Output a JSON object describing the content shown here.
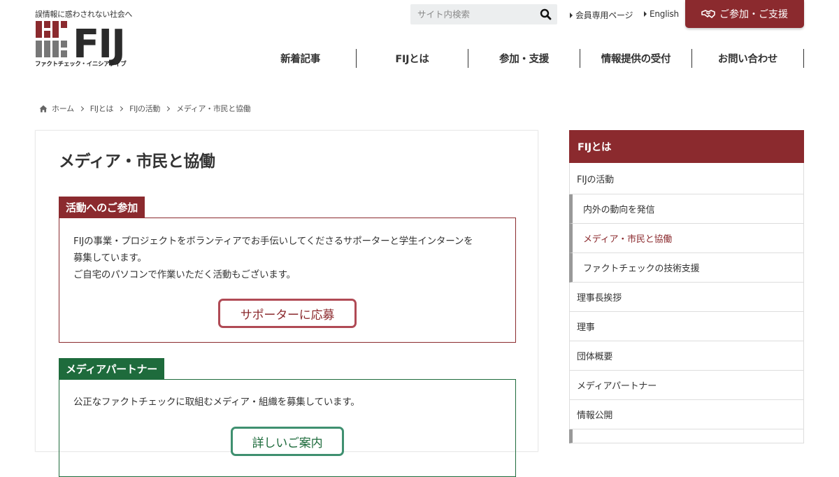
{
  "header": {
    "tagline": "誤情報に惑わされない社会へ",
    "logo_text": "FIJ",
    "logo_sub": "ファクトチェック・イニシアティブ",
    "search_placeholder": "サイト内検索",
    "links": [
      {
        "label": "会員専用ページ"
      },
      {
        "label": "English"
      }
    ],
    "join_label": "ご参加・ご支援",
    "nav": [
      {
        "label": "新着記事"
      },
      {
        "label": "FIJとは"
      },
      {
        "label": "参加・支援"
      },
      {
        "label": "情報提供の受付"
      },
      {
        "label": "お問い合わせ"
      }
    ],
    "colors": {
      "brand": "#8b2a2e",
      "green": "#1e6b3c",
      "grey": "#777777"
    }
  },
  "breadcrumb": [
    "ホーム",
    "FIJとは",
    "FIJの活動",
    "メディア・市民と協働"
  ],
  "main": {
    "title": "メディア・市民と協働",
    "sections": [
      {
        "label": "活動へのご参加",
        "lines": [
          "FIJの事業・プロジェクトをボランティアでお手伝いしてくださるサポーターと学生インターンを",
          "募集しています。",
          "ご自宅のパソコンで作業いただく活動もございます。"
        ],
        "button": "サポーターに応募",
        "color": "#8b2a2e"
      },
      {
        "label": "メディアパートナー",
        "lines": [
          "公正なファクトチェックに取組むメディア・組織を募集しています。"
        ],
        "button": "詳しいご案内",
        "color": "#1e6b3c"
      }
    ]
  },
  "sidebar": {
    "heading": "FIJとは",
    "items": [
      {
        "label": "FIJの活動"
      },
      {
        "label": "内外の動向を発信"
      },
      {
        "label": "メディア・市民と協働"
      },
      {
        "label": "ファクトチェックの技術支援"
      },
      {
        "label": "理事長挨拶"
      },
      {
        "label": "理事"
      },
      {
        "label": "団体概要"
      },
      {
        "label": "メディアパートナー"
      },
      {
        "label": "情報公開"
      }
    ]
  }
}
